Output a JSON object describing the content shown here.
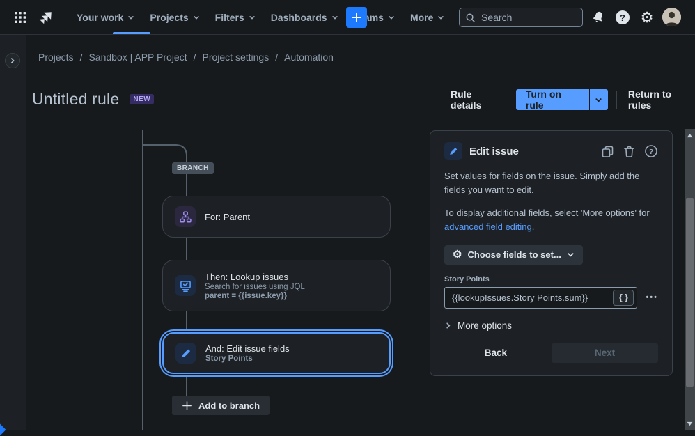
{
  "nav": {
    "items": [
      {
        "label": "Your work"
      },
      {
        "label": "Projects",
        "active": true
      },
      {
        "label": "Filters"
      },
      {
        "label": "Dashboards"
      },
      {
        "label": "Teams"
      },
      {
        "label": "More"
      }
    ],
    "search_placeholder": "Search"
  },
  "breadcrumb": {
    "separator": "/",
    "items": [
      "Projects",
      "Sandbox | APP Project",
      "Project settings",
      "Automation"
    ]
  },
  "header": {
    "title": "Untitled rule",
    "badge": "NEW",
    "rule_details_label": "Rule details",
    "turn_on_label": "Turn on rule",
    "return_label": "Return to rules"
  },
  "canvas": {
    "branch_label": "BRANCH",
    "nodes": [
      {
        "title": "For: Parent",
        "icon": "hierarchy-icon"
      },
      {
        "title": "Then: Lookup issues",
        "subtitle": "Search for issues using JQL",
        "detail": "parent = {{issue.key}}",
        "icon": "lookup-icon"
      },
      {
        "title": "And: Edit issue fields",
        "subtitle": "Story Points",
        "icon": "pencil-icon",
        "selected": true
      }
    ],
    "add_branch_label": "Add to branch"
  },
  "panel": {
    "title": "Edit issue",
    "description_1": "Set values for fields on the issue. Simply add the fields you want to edit.",
    "description_2_prefix": "To display additional fields, select 'More options' for ",
    "description_2_link": "advanced field editing",
    "description_2_suffix": ".",
    "choose_fields_label": "Choose fields to set...",
    "field_label": "Story Points",
    "field_value": "{{lookupIssues.Story Points.sum}}",
    "braces_label": "{ }",
    "dots_label": "•••",
    "more_options_label": "More options",
    "back_label": "Back",
    "next_label": "Next"
  },
  "colors": {
    "accent_blue": "#579DFF",
    "brand_blue": "#1D7AFC",
    "link_blue": "#579DFF",
    "badge_purple_bg": "#352C63",
    "badge_purple_text": "#B8ACF6",
    "purple_icon": "#9F8FEF",
    "selected_node_border": "#579DFF"
  }
}
